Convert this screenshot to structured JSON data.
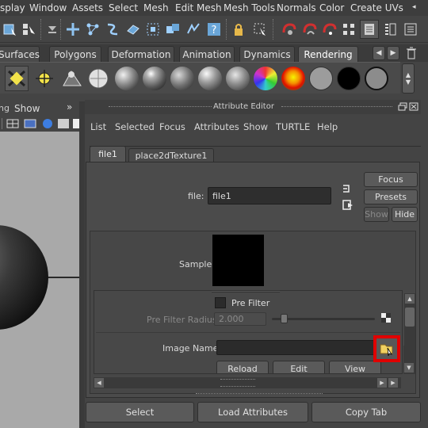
{
  "menubar": {
    "items": [
      "splay",
      "Window",
      "Assets",
      "Select",
      "Mesh",
      "Edit Mesh",
      "Mesh Tools",
      "Normals",
      "Color",
      "Create UVs"
    ]
  },
  "shelf_tabs": {
    "items": [
      "Surfaces",
      "Polygons",
      "Deformation",
      "Animation",
      "Dynamics",
      "Rendering"
    ],
    "active": "Rendering"
  },
  "shelf": {
    "icons": [
      "directional-light-icon",
      "point-light-icon",
      "spot-light-icon",
      "checker-sphere-icon"
    ],
    "swatch_colors": [
      "#9c9c9c",
      "#000000",
      "#8c8c8c"
    ]
  },
  "viewport": {
    "menu_label": "Show"
  },
  "attribute_editor": {
    "title": "Attribute Editor",
    "menu": [
      "List",
      "Selected",
      "Focus",
      "Attributes",
      "Show",
      "TURTLE",
      "Help"
    ],
    "tabs": [
      "file1",
      "place2dTexture1"
    ],
    "file_label": "file:",
    "file_value": "file1",
    "buttons": {
      "focus": "Focus",
      "presets": "Presets",
      "show": "Show",
      "hide": "Hide"
    },
    "sample_label": "Sample",
    "pre_filter_label": "Pre Filter",
    "pre_filter_radius_label": "Pre Filter Radius",
    "pre_filter_radius_value": "2.000",
    "image_name_label": "Image Name",
    "image_name_value": "",
    "reload_label": "Reload",
    "edit_label": "Edit",
    "view_label": "View",
    "bottom_buttons": {
      "select": "Select",
      "load_attributes": "Load Attributes",
      "copy_tab": "Copy Tab"
    },
    "highlight_color": "#e00000"
  }
}
